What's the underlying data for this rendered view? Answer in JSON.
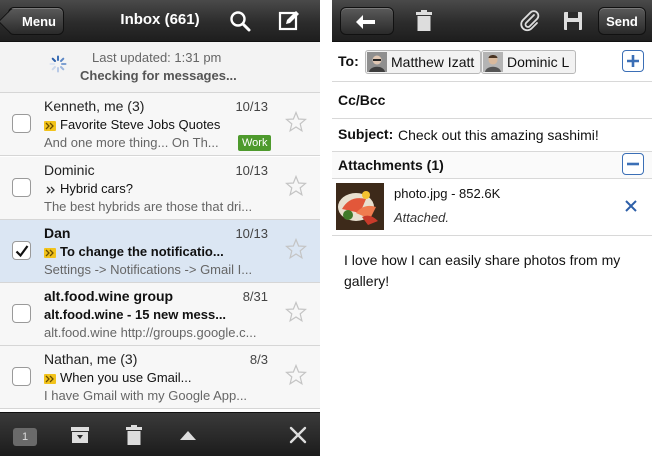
{
  "inbox": {
    "menu_label": "Menu",
    "title": "Inbox (661)",
    "status": {
      "last_updated": "Last updated: 1:31 pm",
      "checking": "Checking for messages..."
    },
    "emails": [
      {
        "sender": "Kenneth, me (3)",
        "date": "10/13",
        "subject": "Favorite Steve Jobs Quotes",
        "preview": "And one more thing... On Th...",
        "label": "Work",
        "unread": false,
        "checked": false,
        "priority": "important"
      },
      {
        "sender": "Dominic",
        "date": "10/13",
        "subject": "Hybrid cars?",
        "preview": "The best hybrids are those that dri...",
        "label": "",
        "unread": false,
        "checked": false,
        "priority": "normal"
      },
      {
        "sender": "Dan",
        "date": "10/13",
        "subject": "To change the notificatio...",
        "preview": "Settings -> Notifications -> Gmail I...",
        "label": "",
        "unread": true,
        "checked": true,
        "priority": "important"
      },
      {
        "sender": "alt.food.wine group",
        "date": "8/31",
        "subject": "alt.food.wine - 15 new mess...",
        "preview": "alt.food.wine http://groups.google.c...",
        "label": "",
        "unread": true,
        "checked": false,
        "priority": "none"
      },
      {
        "sender": "Nathan, me (3)",
        "date": "8/3",
        "subject": "When you use Gmail...",
        "preview": "I have Gmail with my Google App...",
        "label": "",
        "unread": false,
        "checked": false,
        "priority": "important"
      }
    ],
    "toolbar": {
      "selected_count": "1"
    },
    "colors": {
      "selected_row": "#dbe6f3",
      "work_label": "#4e9a2d"
    }
  },
  "compose": {
    "send_label": "Send",
    "to_label": "To:",
    "recipients": [
      "Matthew Izatt",
      "Dominic L"
    ],
    "ccbcc_label": "Cc/Bcc",
    "subject_label": "Subject:",
    "subject_value": "Check out this amazing sashimi!",
    "attachments_label": "Attachments (1)",
    "attachment": {
      "name": "photo.jpg - 852.6K",
      "status": "Attached."
    },
    "body": "I love how I can easily share photos from my gallery!",
    "colors": {
      "accent": "#3b6fb6"
    }
  }
}
